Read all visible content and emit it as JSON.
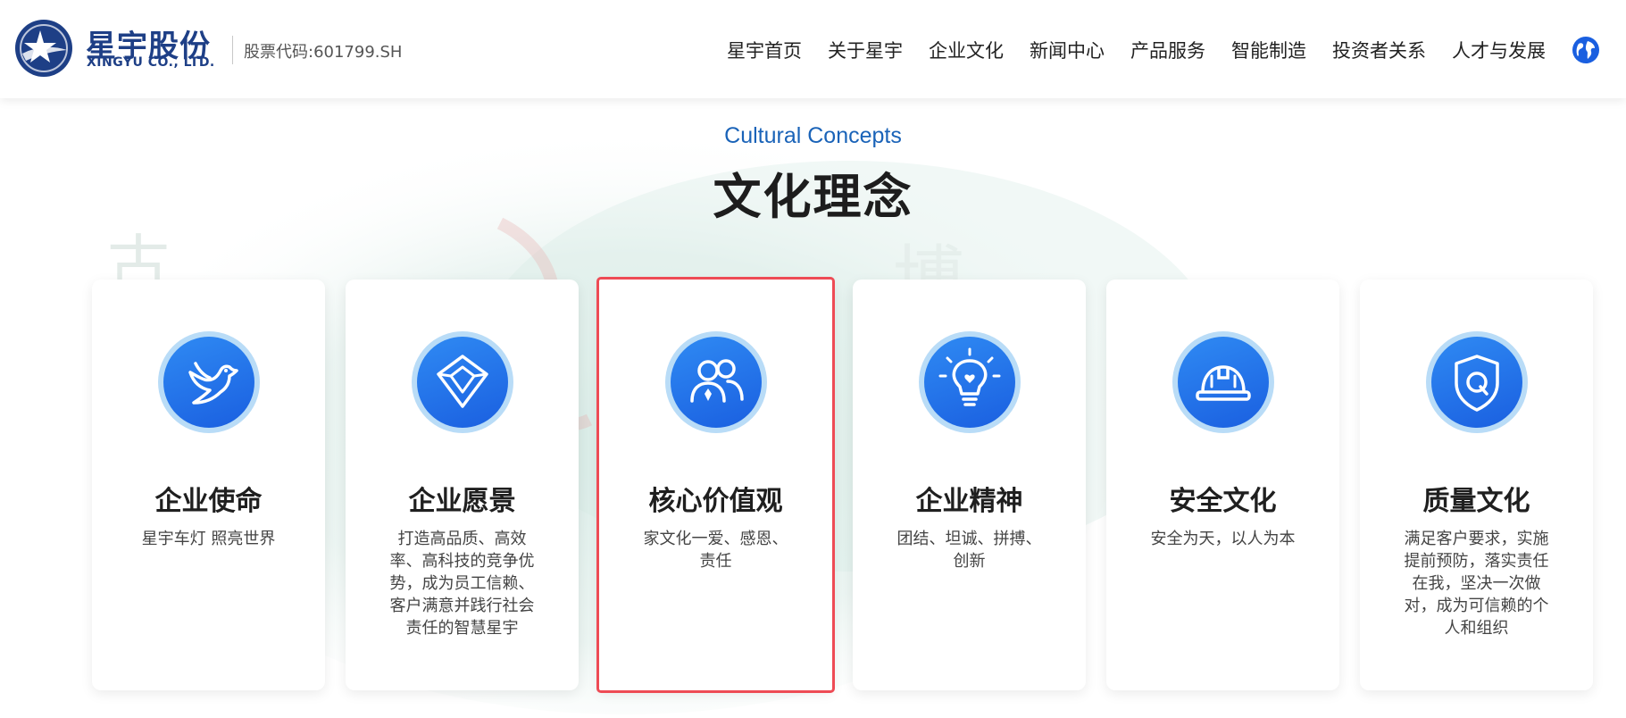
{
  "header": {
    "logo_cn": "星宇股份",
    "logo_en": "XINGYU CO., LTD.",
    "stock_code": "股票代码:601799.SH",
    "nav": [
      "星宇首页",
      "关于星宇",
      "企业文化",
      "新闻中心",
      "产品服务",
      "智能制造",
      "投资者关系",
      "人才与发展"
    ],
    "language_icon": "globe-icon"
  },
  "section": {
    "subtitle": "Cultural Concepts",
    "title": "文化理念"
  },
  "cards": [
    {
      "icon": "dove-icon",
      "title": "企业使命",
      "desc": "星宇车灯 照亮世界"
    },
    {
      "icon": "diamond-icon",
      "title": "企业愿景",
      "desc": "打造高品质、高效率、高科技的竞争优势，成为员工信赖、客户满意并践行社会责任的智慧星宇"
    },
    {
      "icon": "people-icon",
      "title": "核心价值观",
      "desc": "家文化一爱、感恩、责任"
    },
    {
      "icon": "lightbulb-icon",
      "title": "企业精神",
      "desc": "团结、坦诚、拼搏、创新"
    },
    {
      "icon": "helmet-icon",
      "title": "安全文化",
      "desc": "安全为天，以人为本"
    },
    {
      "icon": "shield-q-icon",
      "title": "质量文化",
      "desc": "满足客户要求，实施提前预防，落实责任在我，坚决一次做对，成为可信赖的个人和组织"
    }
  ],
  "active_card_index": 2,
  "colors": {
    "brand": "#1e3f86",
    "accent_blue": "#1a63b8",
    "icon_gradient_start": "#2f8af3",
    "icon_gradient_end": "#1a5fe0",
    "highlight_border": "#ee4b55"
  }
}
